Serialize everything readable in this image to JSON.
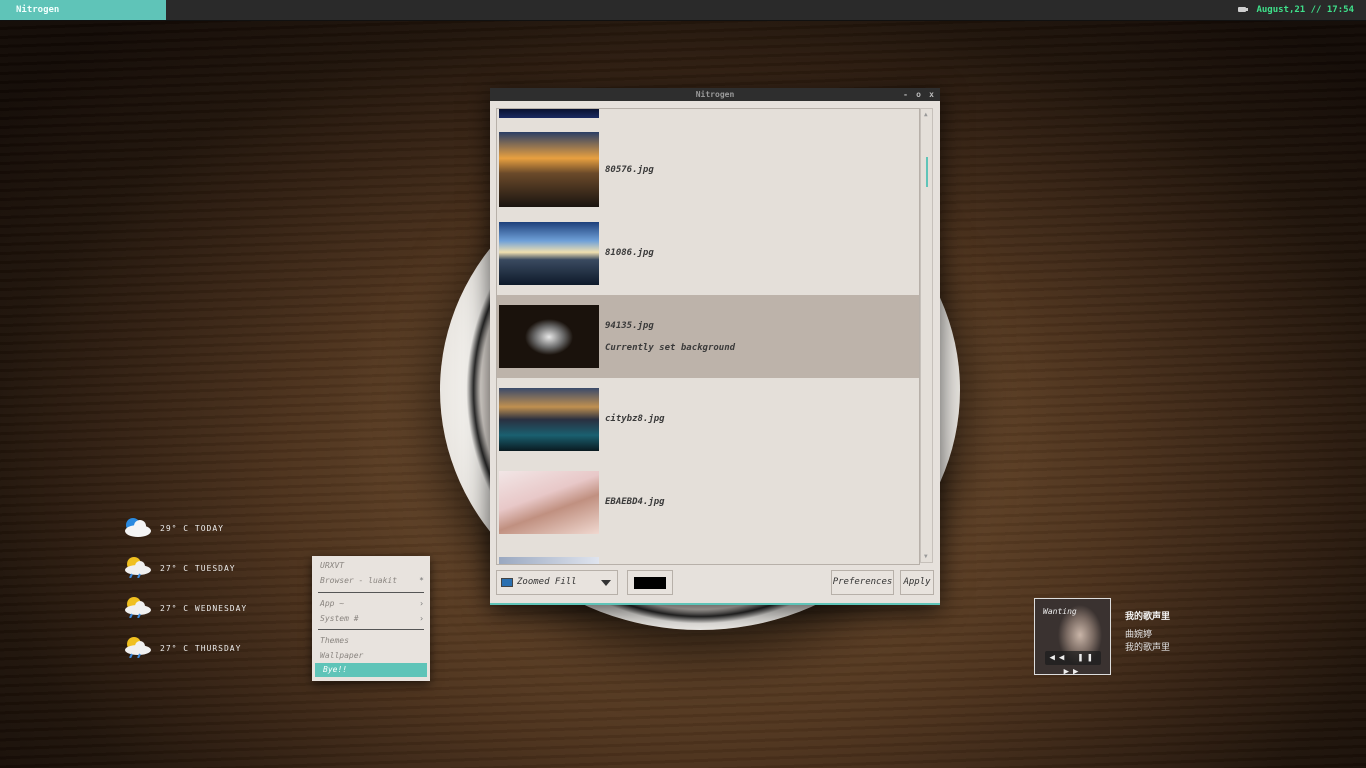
{
  "topbar": {
    "workspace_tag": "Nitrogen",
    "clock": "August,21 // 17:54"
  },
  "window": {
    "title": "Nitrogen",
    "controls": [
      "-",
      "o",
      "x"
    ],
    "files": [
      {
        "name": "80576.jpg",
        "note": ""
      },
      {
        "name": "81086.jpg",
        "note": ""
      },
      {
        "name": "94135.jpg",
        "note": "Currently set background",
        "selected": true
      },
      {
        "name": "citybz8.jpg",
        "note": ""
      },
      {
        "name": "EBAEBD4.jpg",
        "note": ""
      }
    ],
    "mode_select": "Zoomed Fill",
    "bg_color": "#000000",
    "preferences_button": "Preferences",
    "apply_button": "Apply"
  },
  "weather": [
    {
      "label": "29° C TODAY",
      "icon": "cloud-sun-icon"
    },
    {
      "label": "27° C TUESDAY",
      "icon": "sun-cloud-rain-icon"
    },
    {
      "label": "27° C WEDNESDAY",
      "icon": "sun-cloud-rain-icon"
    },
    {
      "label": "27° C THURSDAY",
      "icon": "sun-cloud-rain-icon"
    }
  ],
  "menu": {
    "items": [
      {
        "label": "URXVT",
        "sub": ""
      },
      {
        "label": "Browser - luakit",
        "sub": "*"
      },
      {
        "label": "App ~",
        "sub": "›"
      },
      {
        "label": "System #",
        "sub": "›"
      },
      {
        "label": "Themes",
        "sub": ""
      },
      {
        "label": "Wallpaper",
        "sub": ""
      },
      {
        "label": "Bye!!",
        "sub": ""
      }
    ]
  },
  "music": {
    "title": "我的歌声里",
    "artist": "曲婉婷",
    "album": "我的歌声里",
    "cover_text": "Wanting",
    "controls": "◀◀ ❚❚ ▶▶"
  },
  "colors": {
    "accent": "#5fc4b8",
    "clock": "#3fe08a"
  }
}
